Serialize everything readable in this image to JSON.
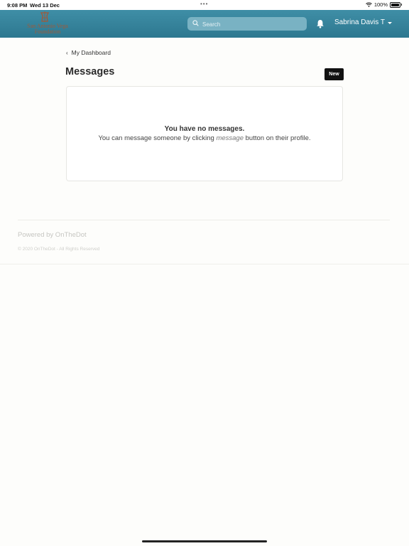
{
  "status_bar": {
    "time": "9:08 PM",
    "date": "Wed 13 Dec",
    "dots": "•••",
    "battery": "100%",
    "icons": [
      "wifi-icon",
      "battery-icon"
    ]
  },
  "navbar": {
    "logo_text": "San Antonio Vega Foundation",
    "search_placeholder": "Search",
    "user_name": "Sabrina Davis T",
    "icons": [
      "search-icon",
      "bell-icon",
      "caret-down-icon"
    ],
    "colors": {
      "bar": "#2f7b93",
      "search_bg": "#79b2c3",
      "logo": "#a05a39"
    }
  },
  "breadcrumb": {
    "label": "My Dashboard"
  },
  "page": {
    "title": "Messages",
    "new_button": "New"
  },
  "empty_state": {
    "title": "You have no messages.",
    "text_before": "You can message someone by clicking ",
    "emphasis": "message",
    "text_after": " button on their profile."
  },
  "footer": {
    "powered": "Powered by OnTheDot",
    "copyright": "© 2020 OnTheDot - All Rights Reserved"
  }
}
